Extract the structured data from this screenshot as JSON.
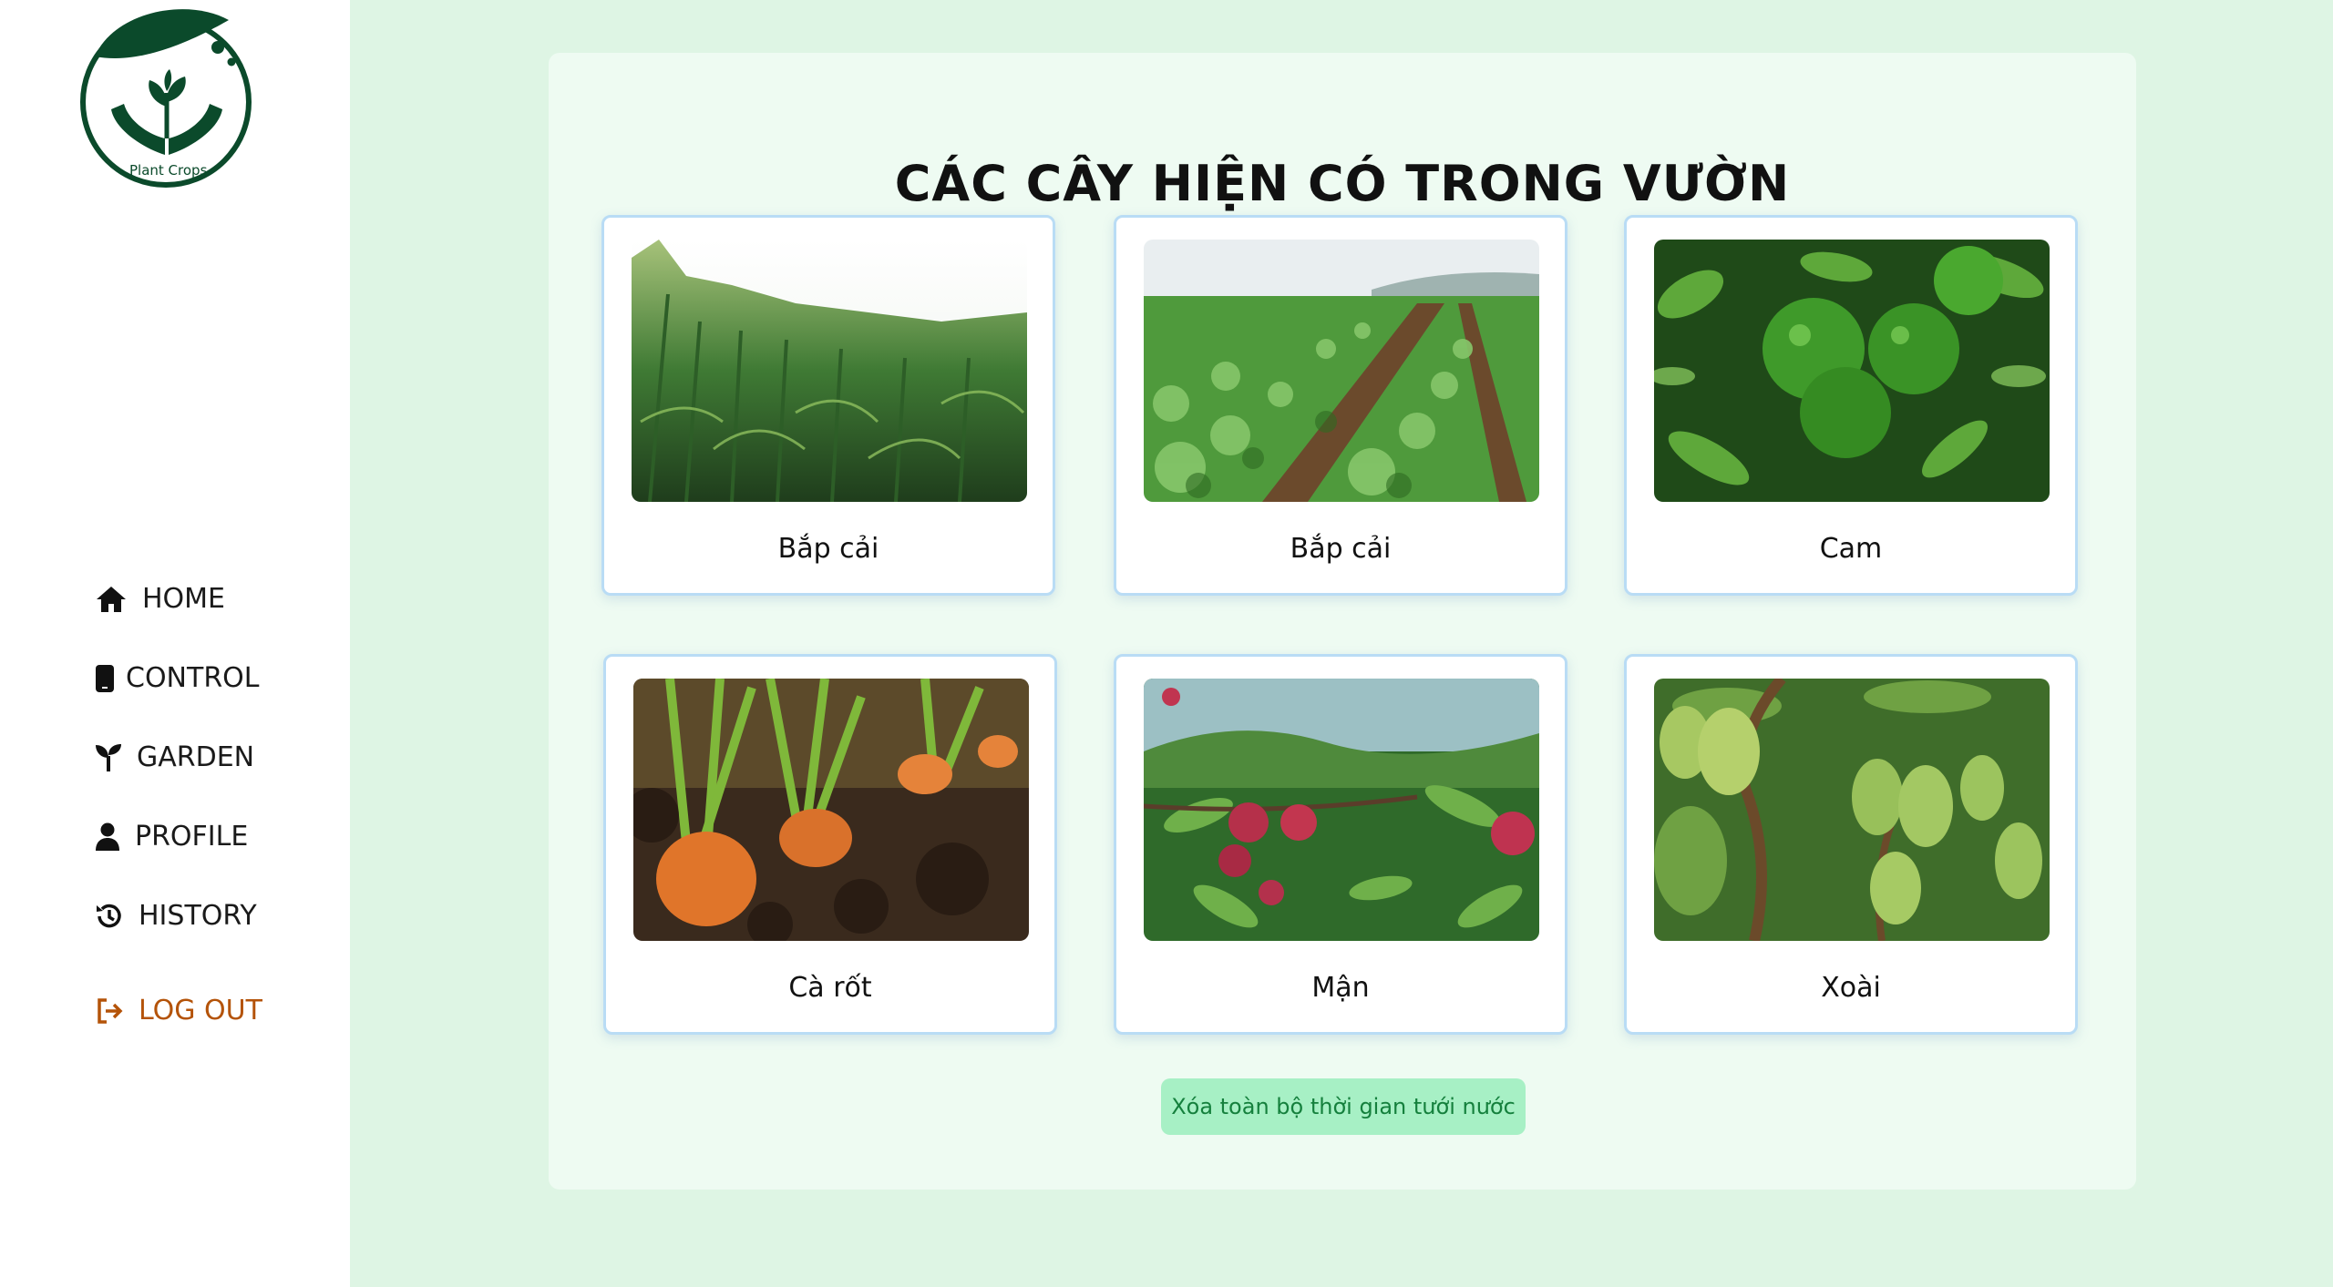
{
  "app": {
    "logo_text": "Plant Crops"
  },
  "sidebar": {
    "items": [
      {
        "label": "HOME",
        "icon": "home-icon"
      },
      {
        "label": "CONTROL",
        "icon": "phone-icon"
      },
      {
        "label": "GARDEN",
        "icon": "sprout-icon"
      },
      {
        "label": "PROFILE",
        "icon": "user-icon"
      },
      {
        "label": "HISTORY",
        "icon": "history-icon"
      }
    ],
    "logout": {
      "label": "LOG OUT",
      "icon": "logout-icon",
      "color": "#b45309"
    }
  },
  "main": {
    "title": "CÁC CÂY HIỆN CÓ TRONG VƯỜN",
    "plants": [
      {
        "name": "Bắp cải",
        "image": "corn-field-photo"
      },
      {
        "name": "Bắp cải",
        "image": "cabbage-field-photo"
      },
      {
        "name": "Cam",
        "image": "orange-tree-photo"
      },
      {
        "name": "Cà rốt",
        "image": "carrot-soil-photo"
      },
      {
        "name": "Mận",
        "image": "plum-tree-photo"
      },
      {
        "name": "Xoài",
        "image": "mango-tree-photo"
      }
    ],
    "clear_button": "Xóa toàn bộ thời gian tưới nước"
  },
  "colors": {
    "page_bg": "#def5e4",
    "panel_bg": "#eefbf2",
    "card_border": "#b9dcf5",
    "button_bg": "#a7f0c5",
    "button_text": "#15803d",
    "logo_green": "#0b4a2b"
  }
}
